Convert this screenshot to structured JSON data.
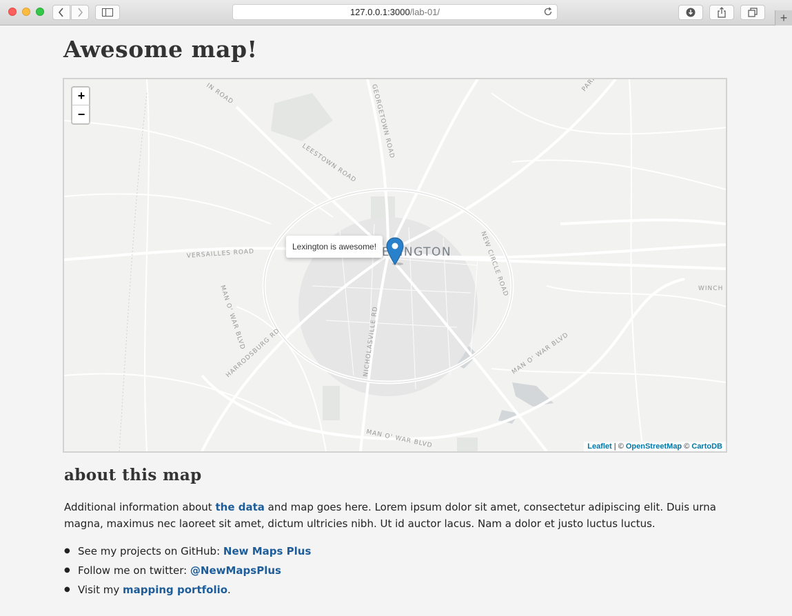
{
  "browser": {
    "url_host": "127.0.0.1:3000",
    "url_path": "/lab-01/"
  },
  "page": {
    "title": "Awesome map!"
  },
  "map": {
    "zoom_in_label": "+",
    "zoom_out_label": "−",
    "popup_text": "Lexington is awesome!",
    "city_label": "LEXINGTON",
    "marker_color": "#2a81cb",
    "road_labels": {
      "leestown": "LEESTOWN ROAD",
      "georgetown": "GEORGETOWN ROAD",
      "versailles": "VERSAILLES ROAD",
      "new_circle": "NEW CIRCLE ROAD",
      "nicholasville": "NICHOLASVILLE RD",
      "harrodsburg": "HARRODSBURG RD",
      "man_o_war_w": "MAN O' WAR BLVD",
      "man_o_war_e": "MAN O' WAR BLVD",
      "man_o_war_s": "MAN O' WAR BLVD",
      "winch": "WINCH",
      "top_left": "IN ROAD",
      "paris": "PARIS"
    },
    "attribution": {
      "leaflet": "Leaflet",
      "sep1": " | © ",
      "osm": "OpenStreetMap",
      "sep2": " © ",
      "carto": "CartoDB"
    }
  },
  "about": {
    "heading": "about this map",
    "para_before_link": "Additional information about ",
    "para_link": "the data",
    "para_after_link": " and map goes here. Lorem ipsum dolor sit amet, consectetur adipiscing elit. Duis urna magna, maximus nec laoreet sit amet, dictum ultricies nibh. Ut id auctor lacus. Nam a dolor et justo luctus luctus."
  },
  "links": [
    {
      "prefix": "See my projects on GitHub: ",
      "link": "New Maps Plus",
      "suffix": ""
    },
    {
      "prefix": "Follow me on twitter: ",
      "link": "@NewMapsPlus",
      "suffix": ""
    },
    {
      "prefix": "Visit my ",
      "link": "mapping portfolio",
      "suffix": "."
    }
  ],
  "colors": {
    "link": "#1e5d99",
    "attribution_link": "#0078a8"
  }
}
